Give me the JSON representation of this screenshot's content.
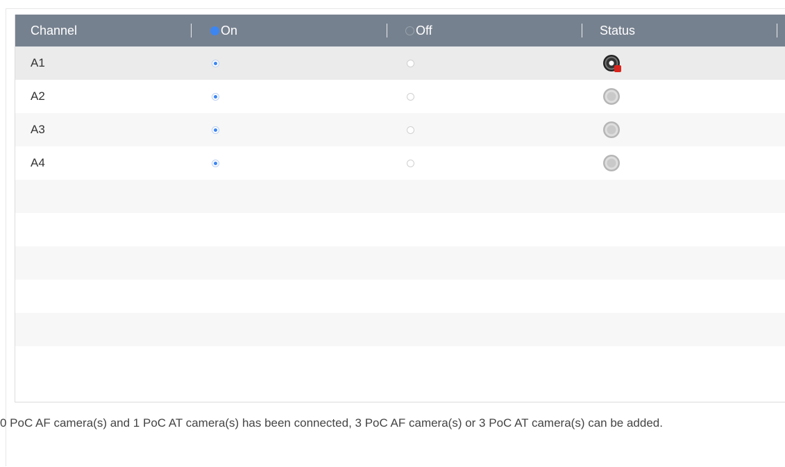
{
  "columns": {
    "channel": "Channel",
    "on": "On",
    "off": "Off",
    "status": "Status"
  },
  "rows": [
    {
      "channel": "A1",
      "on": true,
      "off": false,
      "status": "offline-error",
      "status_icon": "camera-error-icon"
    },
    {
      "channel": "A2",
      "on": true,
      "off": false,
      "status": "idle",
      "status_icon": "camera-idle-icon"
    },
    {
      "channel": "A3",
      "on": true,
      "off": false,
      "status": "idle",
      "status_icon": "camera-idle-icon"
    },
    {
      "channel": "A4",
      "on": true,
      "off": false,
      "status": "idle",
      "status_icon": "camera-idle-icon"
    }
  ],
  "footer": {
    "message": "0 PoC AF camera(s) and 1 PoC AT camera(s) has been connected, 3 PoC AF camera(s) or 3 PoC AT camera(s) can be added."
  },
  "colors": {
    "header_bg": "#76818f",
    "accent": "#3d86f2",
    "error": "#d9251d"
  }
}
